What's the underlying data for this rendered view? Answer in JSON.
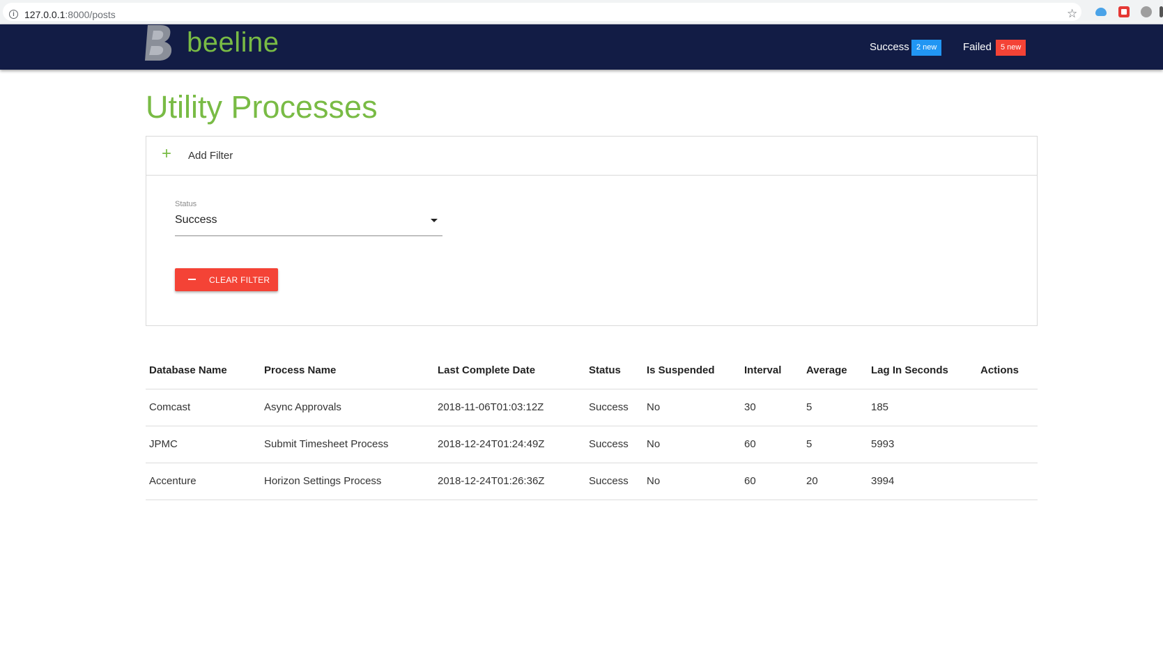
{
  "browser": {
    "url_host": "127.0.0.1",
    "url_path": ":8000/posts"
  },
  "header": {
    "logo_text": "beeline",
    "nav": [
      {
        "label": "Success",
        "badge": "2 new",
        "badge_color": "#2196f3"
      },
      {
        "label": "Failed",
        "badge": "5 new",
        "badge_color": "#f44336"
      }
    ]
  },
  "page": {
    "title": "Utility Processes"
  },
  "filter": {
    "add_label": "Add Filter",
    "field_label": "Status",
    "field_value": "Success",
    "clear_label": "CLEAR FILTER"
  },
  "table": {
    "headers": [
      "Database Name",
      "Process Name",
      "Last Complete Date",
      "Status",
      "Is Suspended",
      "Interval",
      "Average",
      "Lag In Seconds",
      "Actions"
    ],
    "rows": [
      [
        "Comcast",
        "Async Approvals",
        "2018-11-06T01:03:12Z",
        "Success",
        "No",
        "30",
        "5",
        "185",
        ""
      ],
      [
        "JPMC",
        "Submit Timesheet Process",
        "2018-12-24T01:24:49Z",
        "Success",
        "No",
        "60",
        "5",
        "5993",
        ""
      ],
      [
        "Accenture",
        "Horizon Settings Process",
        "2018-12-24T01:26:36Z",
        "Success",
        "No",
        "60",
        "20",
        "3994",
        ""
      ]
    ]
  },
  "colors": {
    "accent": "#79bb45",
    "header_bg": "#121c45",
    "danger": "#f44336",
    "info": "#2196f3"
  }
}
